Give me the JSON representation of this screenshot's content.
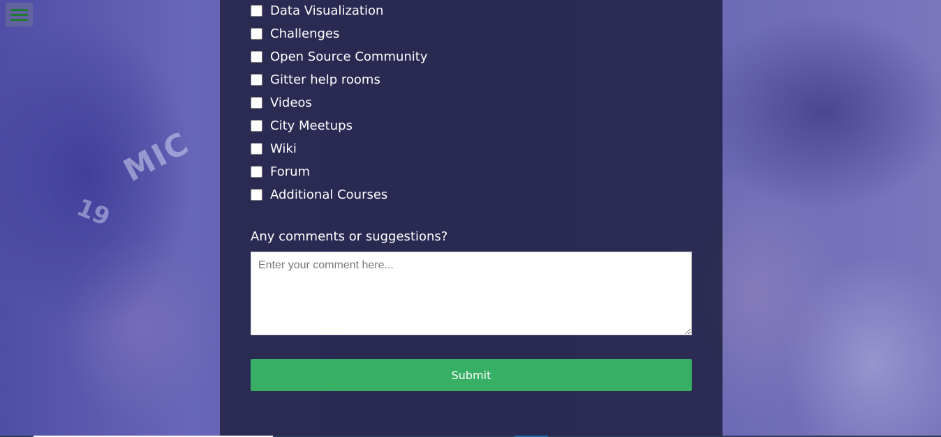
{
  "menu": {
    "icon": "hamburger-menu-icon",
    "icon_color": "#1e7a30"
  },
  "checkboxes": [
    {
      "label": "Data Visualization",
      "checked": false
    },
    {
      "label": "Challenges",
      "checked": false
    },
    {
      "label": "Open Source Community",
      "checked": false
    },
    {
      "label": "Gitter help rooms",
      "checked": false
    },
    {
      "label": "Videos",
      "checked": false
    },
    {
      "label": "City Meetups",
      "checked": false
    },
    {
      "label": "Wiki",
      "checked": false
    },
    {
      "label": "Forum",
      "checked": false
    },
    {
      "label": "Additional Courses",
      "checked": false
    }
  ],
  "comments": {
    "label": "Any comments or suggestions?",
    "placeholder": "Enter your comment here...",
    "value": ""
  },
  "submit": {
    "label": "Submit",
    "color": "#37af65"
  },
  "background": {
    "shirt_text": "MIC",
    "shirt_number": "19"
  }
}
